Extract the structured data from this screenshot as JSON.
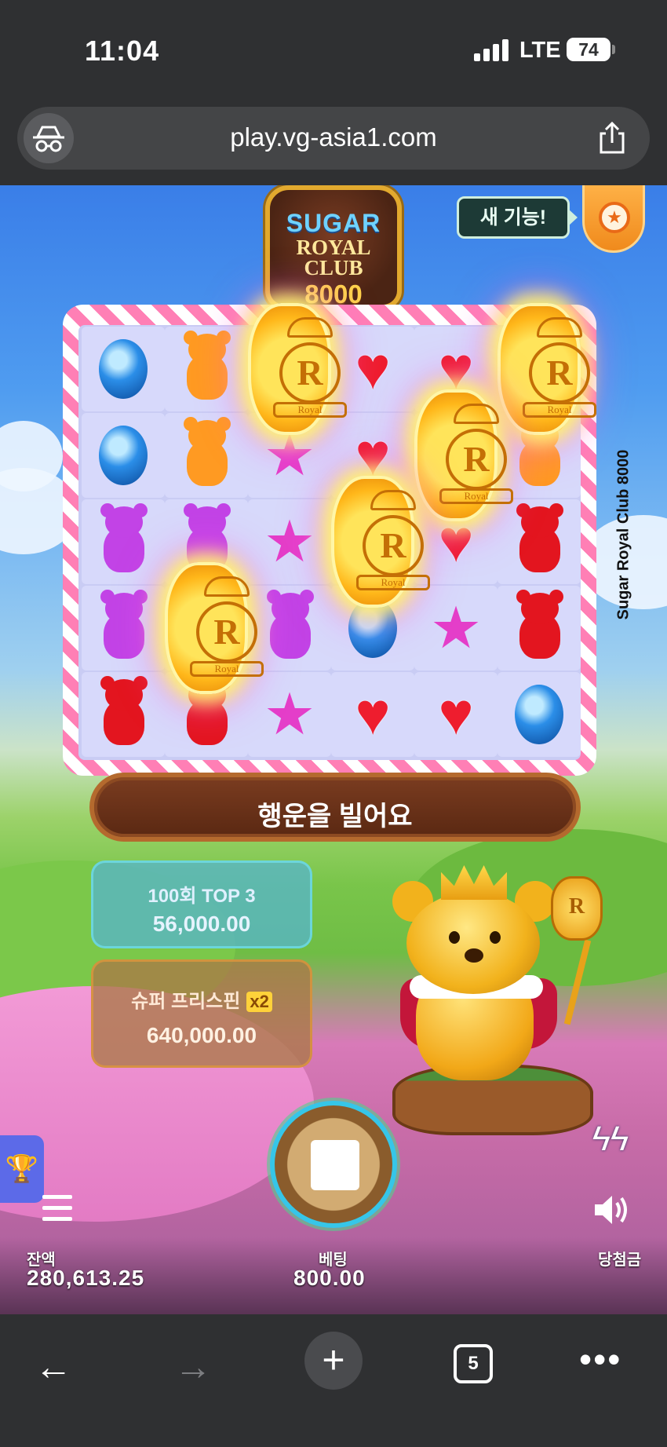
{
  "status_bar": {
    "time": "11:04",
    "network": "LTE",
    "battery": "74"
  },
  "browser": {
    "url": "play.vg-asia1.com",
    "open_tabs": "5",
    "icons": {
      "privacy": "incognito-glasses-icon",
      "share": "share-icon",
      "back": "arrow-left-icon",
      "forward": "arrow-right-icon",
      "new_tab": "plus-icon",
      "tabs": "tabs-icon",
      "more": "more-dots-icon"
    }
  },
  "game": {
    "logo": {
      "line1": "SUGAR",
      "line2": "ROYAL",
      "line3": "CLUB",
      "line4": "8000"
    },
    "side_title": "Sugar Royal Club 8000",
    "new_feature_label": "새 기능!",
    "banner_message": "행운을 빌어요",
    "buy_options": [
      {
        "title": "100회 TOP 3",
        "price": "56,000.00"
      },
      {
        "title": "슈퍼 프리스핀",
        "multiplier": "x2",
        "price": "640,000.00"
      }
    ],
    "grid_rows": [
      [
        "blue-candy",
        "orange-bear",
        "scatter",
        "red-heart",
        "red-heart",
        "scatter"
      ],
      [
        "blue-candy",
        "orange-bear",
        "pink-star",
        "red-heart",
        "scatter",
        "orange-bear"
      ],
      [
        "purple-bear",
        "purple-bear",
        "pink-star",
        "scatter",
        "red-heart",
        "red-bear"
      ],
      [
        "purple-bear",
        "scatter",
        "purple-bear",
        "blue-candy",
        "pink-star",
        "red-bear"
      ],
      [
        "red-bear",
        "red-bear",
        "pink-star",
        "red-heart",
        "red-heart",
        "blue-candy"
      ]
    ],
    "scatter_symbol": {
      "letter": "R",
      "word": "Royal"
    },
    "controls": {
      "balance_label": "잔액",
      "balance_value": "280,613.25",
      "bet_label": "베팅",
      "bet_value": "800.00",
      "win_label": "당첨금",
      "icons": {
        "trophy": "trophy-icon",
        "menu": "menu-icon",
        "spin": "stop-icon",
        "turbo": "lightning-icon",
        "sound": "speaker-icon"
      }
    }
  }
}
